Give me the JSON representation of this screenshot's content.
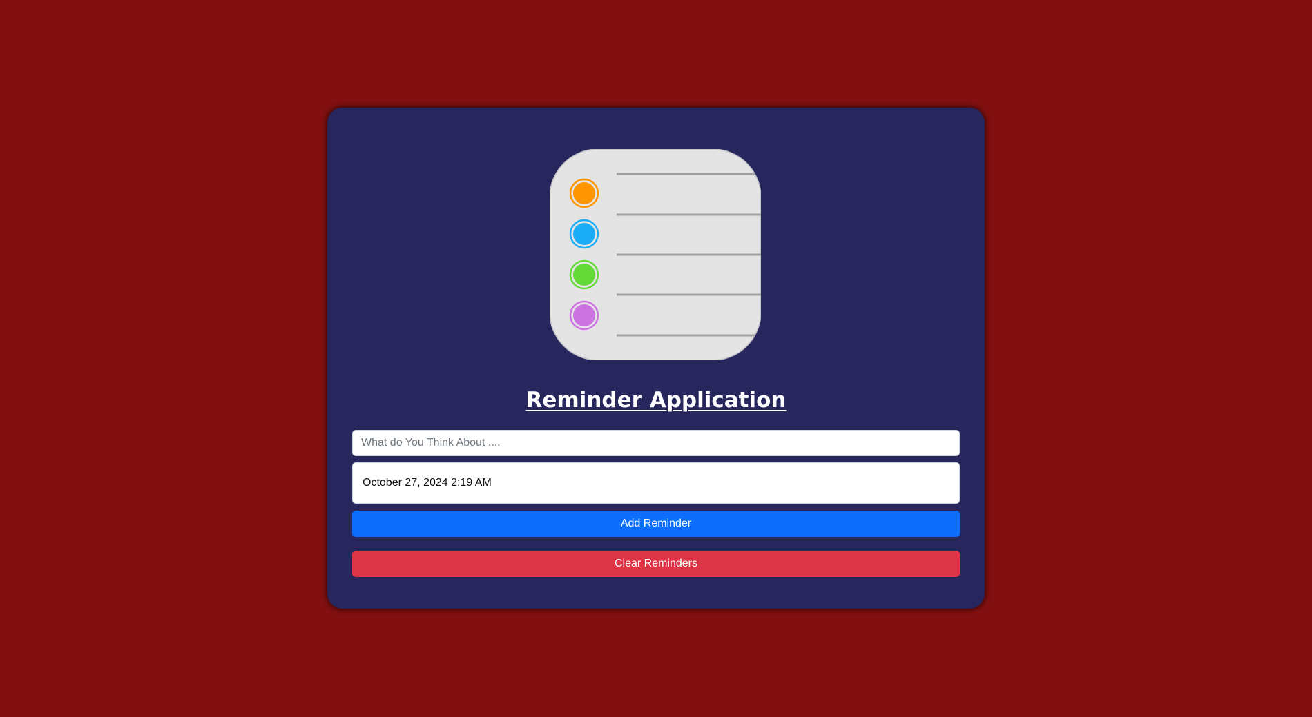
{
  "app": {
    "title": "Reminder Application"
  },
  "logo": {
    "icon": "reminders-list-icon",
    "dot_colors": [
      "#ff9500",
      "#1badf8",
      "#63da38",
      "#cc73e1"
    ]
  },
  "form": {
    "reminder_input": {
      "value": "",
      "placeholder": "What do You Think About ...."
    },
    "date_field": {
      "value": "October 27, 2024 2:19 AM"
    },
    "add_button_label": "Add Reminder",
    "clear_button_label": "Clear Reminders"
  },
  "colors": {
    "page_background": "#831010",
    "card_background": "#27265d",
    "add_button": "#0d6efd",
    "clear_button": "#dc3545"
  }
}
